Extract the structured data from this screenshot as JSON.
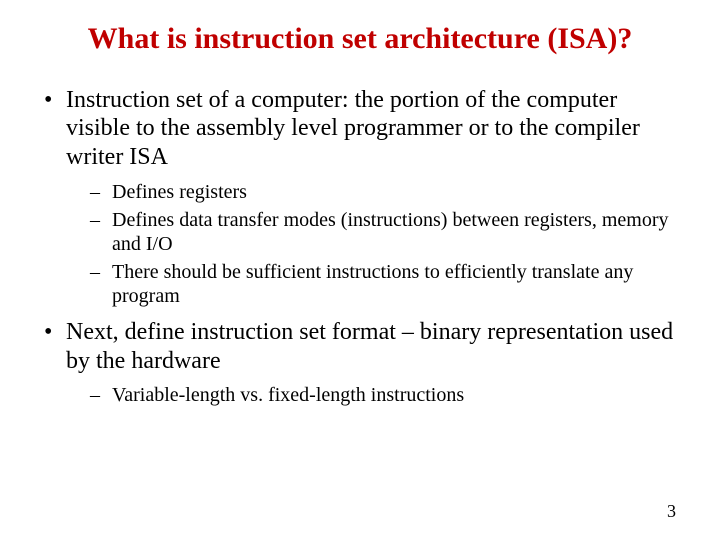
{
  "title": "What is instruction set architecture (ISA)?",
  "bullets": [
    {
      "text": "Instruction set of a computer: the portion of the computer visible to the assembly level programmer or to the compiler writer ISA",
      "subs": [
        "Defines registers",
        "Defines data transfer modes (instructions) between registers, memory and I/O",
        "There should be sufficient instructions to efficiently translate any program"
      ]
    },
    {
      "text": "Next, define instruction set format – binary representation used by the hardware",
      "subs": [
        "Variable-length vs. fixed-length instructions"
      ]
    }
  ],
  "pageNumber": "3"
}
